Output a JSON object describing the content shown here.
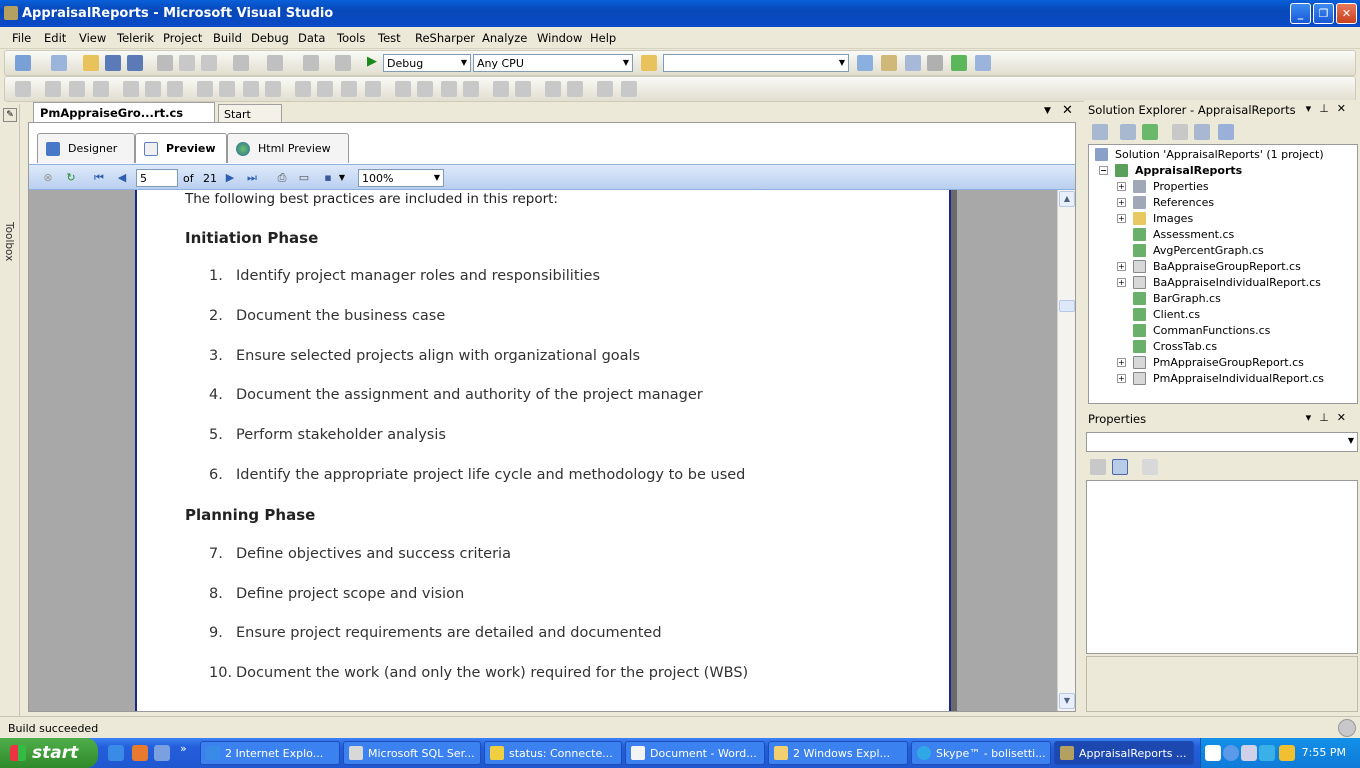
{
  "window": {
    "title": "AppraisalReports - Microsoft Visual Studio"
  },
  "menu": [
    "File",
    "Edit",
    "View",
    "Telerik",
    "Project",
    "Build",
    "Debug",
    "Data",
    "Tools",
    "Test",
    "ReSharper",
    "Analyze",
    "Window",
    "Help"
  ],
  "toolbar": {
    "config": "Debug",
    "platform": "Any CPU",
    "find": ""
  },
  "toolbox": {
    "label": "Toolbox"
  },
  "doc_tabs": {
    "active": "PmAppraiseGro...rt.cs [Design]",
    "other": "Start Page"
  },
  "report_tabs": {
    "designer": "Designer",
    "preview": "Preview",
    "html_preview": "Html Preview"
  },
  "viewer": {
    "page": "5",
    "of_label": "of",
    "total_pages": "21",
    "zoom": "100%"
  },
  "report": {
    "intro": "The following best practices are included in this report:",
    "phases": [
      "Initiation Phase",
      "Planning Phase"
    ],
    "items": [
      {
        "num": "1.",
        "text": "Identify project manager roles and responsibilities"
      },
      {
        "num": "2.",
        "text": "Document the business case"
      },
      {
        "num": "3.",
        "text": "Ensure selected projects align with organizational goals"
      },
      {
        "num": "4.",
        "text": "Document the assignment and authority of the project manager"
      },
      {
        "num": "5.",
        "text": "Perform stakeholder analysis"
      },
      {
        "num": "6.",
        "text": "Identify the appropriate project life cycle and methodology to be used"
      },
      {
        "num": "7.",
        "text": "Define objectives and success criteria"
      },
      {
        "num": "8.",
        "text": "Define project scope and vision"
      },
      {
        "num": "9.",
        "text": "Ensure project requirements are detailed and documented"
      },
      {
        "num": "10.",
        "text": "Document the work (and only the work) required for the project (WBS)"
      }
    ]
  },
  "solution_explorer": {
    "title": "Solution Explorer - AppraisalReports",
    "solution": "Solution 'AppraisalReports' (1 project)",
    "project": "AppraisalReports",
    "nodes": [
      "Properties",
      "References",
      "Images",
      "Assessment.cs",
      "AvgPercentGraph.cs",
      "BaAppraiseGroupReport.cs",
      "BaAppraiseIndividualReport.cs",
      "BarGraph.cs",
      "Client.cs",
      "CommanFunctions.cs",
      "CrossTab.cs",
      "PmAppraiseGroupReport.cs",
      "PmAppraiseIndividualReport.cs"
    ]
  },
  "properties": {
    "title": "Properties"
  },
  "status": {
    "text": "Build succeeded"
  },
  "taskbar": {
    "start": "start",
    "tasks": [
      "2 Internet Explo...",
      "Microsoft SQL Ser...",
      "status: Connecte...",
      "Document - Word...",
      "2 Windows Expl...",
      "Skype™ - bolisetti...",
      "AppraisalReports ..."
    ],
    "clock": "7:55 PM"
  }
}
